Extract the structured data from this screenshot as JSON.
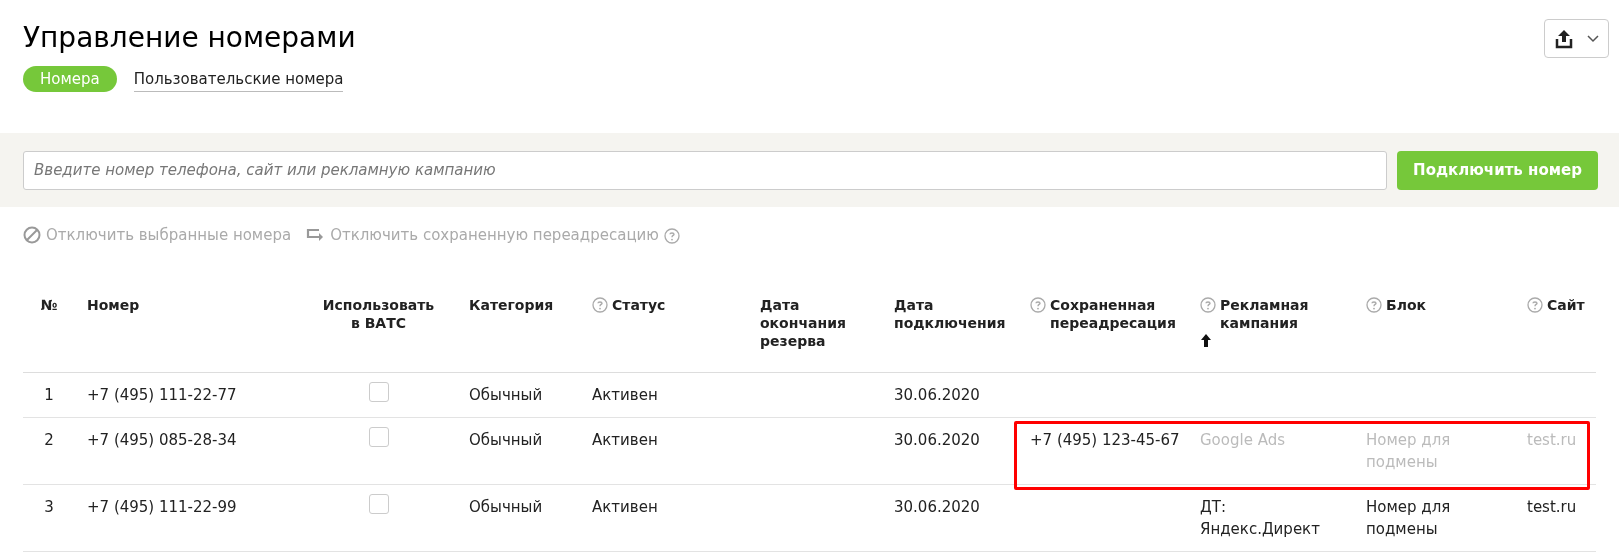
{
  "title": "Управление номерами",
  "tabs": [
    {
      "label": "Номера",
      "selected": true
    },
    {
      "label": "Пользовательские номера",
      "selected": false
    }
  ],
  "search": {
    "placeholder": "Введите номер телефона, сайт или рекламную кампанию"
  },
  "connect_button": "Подключить номер",
  "actions": [
    {
      "kind": "disable",
      "label": "Отключить выбранные номера",
      "help": false
    },
    {
      "kind": "redirect",
      "label": "Отключить сохраненную переадресацию",
      "help": true
    }
  ],
  "table": {
    "columns": [
      {
        "label": "№",
        "help": false,
        "sorted": false
      },
      {
        "label": "Номер",
        "help": false,
        "sorted": false
      },
      {
        "label": "Использовать в ВАТС",
        "help": false,
        "sorted": false
      },
      {
        "label": "Категория",
        "help": false,
        "sorted": false
      },
      {
        "label": "Статус",
        "help": true,
        "sorted": false
      },
      {
        "label": "Дата окончания резерва",
        "help": false,
        "sorted": false
      },
      {
        "label": "Дата подключения",
        "help": false,
        "sorted": false
      },
      {
        "label": "Сохраненная переадресация",
        "help": true,
        "sorted": false
      },
      {
        "label": "Рекламная кампания",
        "help": true,
        "sorted": true
      },
      {
        "label": "Блок",
        "help": true,
        "sorted": false
      },
      {
        "label": "Сайт",
        "help": true,
        "sorted": false
      }
    ],
    "rows": [
      {
        "index": "1",
        "number": "+7 (495) 111-22-77",
        "use_in_pbx": false,
        "category": "Обычный",
        "status": "Активен",
        "connected": "30.06.2020",
        "muted": false,
        "highlighted": false
      },
      {
        "index": "2",
        "number": "+7 (495) 085-28-34",
        "use_in_pbx": false,
        "category": "Обычный",
        "status": "Активен",
        "connected": "30.06.2020",
        "saved_redirect": "+7 (495) 123-45-67",
        "campaign": "Google Ads",
        "block": "Номер для подмены",
        "site": "test.ru",
        "muted": true,
        "highlighted": true
      },
      {
        "index": "3",
        "number": "+7 (495) 111-22-99",
        "use_in_pbx": false,
        "category": "Обычный",
        "status": "Активен",
        "connected": "30.06.2020",
        "campaign": "ДТ: Яндекс.Директ",
        "block": "Номер для подмены",
        "site": "test.ru",
        "muted": false,
        "highlighted": false
      }
    ]
  }
}
